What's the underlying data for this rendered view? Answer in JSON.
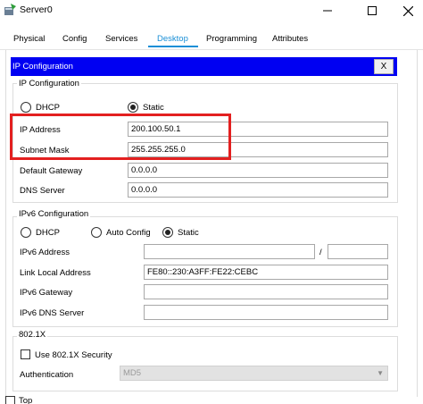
{
  "window": {
    "title": "Server0"
  },
  "tabs": [
    "Physical",
    "Config",
    "Services",
    "Desktop",
    "Programming",
    "Attributes"
  ],
  "panel": {
    "title": "IP Configuration",
    "close_label": "X"
  },
  "ipv4": {
    "group_title": "IP Configuration",
    "dhcp_label": "DHCP",
    "static_label": "Static",
    "selected": "Static",
    "ip_address_label": "IP Address",
    "ip_address": "200.100.50.1",
    "subnet_mask_label": "Subnet Mask",
    "subnet_mask": "255.255.255.0",
    "default_gateway_label": "Default Gateway",
    "default_gateway": "0.0.0.0",
    "dns_server_label": "DNS Server",
    "dns_server": "0.0.0.0"
  },
  "ipv6": {
    "group_title": "IPv6 Configuration",
    "dhcp_label": "DHCP",
    "auto_label": "Auto Config",
    "static_label": "Static",
    "selected": "Static",
    "address_label": "IPv6 Address",
    "address": "",
    "prefix_sep": "/",
    "prefix": "",
    "link_local_label": "Link Local Address",
    "link_local": "FE80::230:A3FF:FE22:CEBC",
    "gateway_label": "IPv6 Gateway",
    "gateway": "",
    "dns_label": "IPv6 DNS Server",
    "dns": ""
  },
  "dot1x": {
    "group_title": "802.1X",
    "use_label": "Use 802.1X Security",
    "auth_label": "Authentication",
    "auth_value": "MD5"
  },
  "footer": {
    "top_label": "Top"
  },
  "colors": {
    "accent": "#1a8fd6",
    "header": "#0000f2",
    "highlight": "#e32020"
  }
}
